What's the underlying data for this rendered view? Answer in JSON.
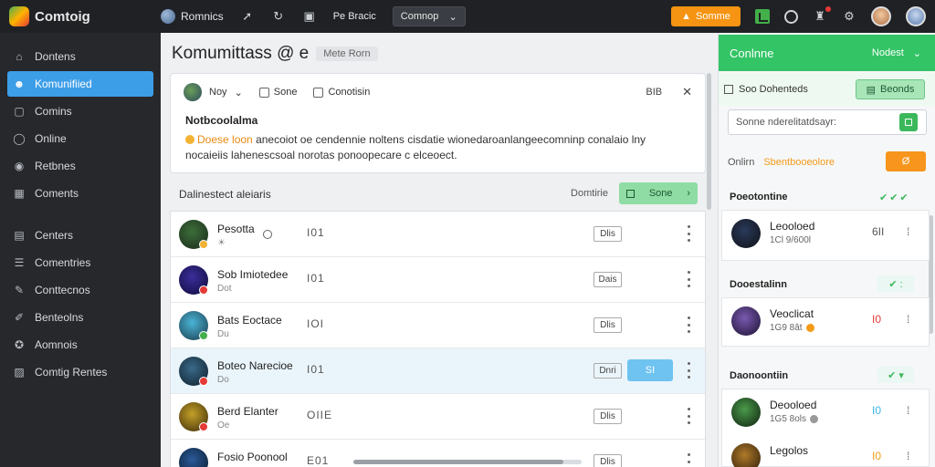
{
  "app": {
    "name": "Comtoig"
  },
  "topbar": {
    "items": [
      "Romnics"
    ],
    "select": "Comnop",
    "select_small": "Pe Bracic",
    "orange_btn": "Somme"
  },
  "sidebar": {
    "group1": [
      {
        "label": "Dontens",
        "icon": "home-icon"
      },
      {
        "label": "Komunifiied",
        "icon": "users-icon",
        "active": true
      },
      {
        "label": "Comins",
        "icon": "square-icon"
      },
      {
        "label": "Online",
        "icon": "chat-icon"
      },
      {
        "label": "Retbnes",
        "icon": "eye-icon"
      },
      {
        "label": "Coments",
        "icon": "building-icon"
      }
    ],
    "group2": [
      {
        "label": "Centers",
        "icon": "grid-icon"
      },
      {
        "label": "Comentries",
        "icon": "list-icon"
      },
      {
        "label": "Conttecnos",
        "icon": "pin-icon"
      },
      {
        "label": "Benteolns",
        "icon": "tag-icon"
      },
      {
        "label": "Aomnois",
        "icon": "game-icon"
      },
      {
        "label": "Comtig Rentes",
        "icon": "chart-icon"
      }
    ]
  },
  "main": {
    "title": "Komumittass @ e",
    "title_chip": "Mete Rorn",
    "composer": {
      "user": "Noy",
      "opt1": "Sone",
      "opt2": "Conotisin",
      "tool1": "BIB",
      "close": "✕",
      "label": "Notbcoolalma",
      "highlight": "Doese loon",
      "line1": "anecoiot oe cendennie noltens cisdatie wionedaroanlangeecomninp conalaio lny",
      "line2_hl": "nocaieiis lahenescsoal",
      "line2": "norotas ponoopecare c elceoect."
    },
    "list": {
      "header": "Dalinestect aleiaris",
      "right_text": "Domtirie",
      "share": "Sone",
      "rows": [
        {
          "name": "Pesotta",
          "sub": "☀",
          "num": "I01",
          "tag": "Dlis",
          "avatar1": "#3d6e3a",
          "avatar2": "#1a2a1a",
          "badge": "#f2b233",
          "ring": true
        },
        {
          "name": "Sob Imiotedee",
          "sub": "Dot",
          "num": "I01",
          "tag": "Dais",
          "avatar1": "#3b2e9a",
          "avatar2": "#0e0b3a",
          "badge": "#e53935"
        },
        {
          "name": "Bats Eoctace",
          "sub": "Du",
          "num": "IOI",
          "tag": "Dlis",
          "avatar1": "#4ab4d6",
          "avatar2": "#1a3a4a",
          "badge": "#43b04a"
        },
        {
          "name": "Boteo Narecioe",
          "sub": "Do",
          "num": "I01",
          "tag": "Dnri",
          "action": "SI",
          "avatar1": "#3a6a8a",
          "avatar2": "#0e1e2a",
          "badge": "#e53935",
          "highlight": true
        },
        {
          "name": "Berd Elanter",
          "sub": "Oe",
          "num": "OIIE",
          "tag": "Dlis",
          "avatar1": "#c4a028",
          "avatar2": "#3a2a0a",
          "badge": "#e53935"
        },
        {
          "name": "Fosio Poonool",
          "sub": "",
          "num": "E01",
          "tag": "Dlis",
          "avatar1": "#2a5a9a",
          "avatar2": "#0a1a2a",
          "badge": "#43b04a"
        }
      ]
    }
  },
  "rpanel": {
    "header": "Conlnne",
    "header_right": "Nodest",
    "sub_label": "Soo Dohenteds",
    "sub_btn": "Beonds",
    "search_value": "Sonne nderelitatdsayr:",
    "online_label": "Onlirn",
    "online_hl": "Sbentbooeolore",
    "online_btn": "Ø",
    "sections": [
      {
        "title": "Poeotontine",
        "icon": "✔✔✔",
        "rows": [
          {
            "name": "Leooloed",
            "meta": "1Cl 9/600l",
            "count": "6II",
            "count_color": "#555",
            "avatar1": "#2a3a5a",
            "avatar2": "#0e1016",
            "dot": ""
          }
        ]
      },
      {
        "title": "Dooestalinn",
        "chip": "✔ :",
        "rows": [
          {
            "name": "Veoclicat",
            "meta": "1G9 8ât",
            "count": "I0",
            "count_color": "#e53935",
            "avatar1": "#7a5ab0",
            "avatar2": "#1a1030",
            "dot": "#f39a18"
          }
        ]
      },
      {
        "title": "Daonoontiin",
        "chip": "✔ ▾",
        "rows": [
          {
            "name": "Deooloed",
            "meta": "1G5 8ols",
            "count": "I0",
            "count_color": "#3db4e8",
            "avatar1": "#4a9a4a",
            "avatar2": "#102010",
            "dot": "#999"
          },
          {
            "name": "Legolos",
            "meta": "",
            "count": "I0",
            "count_color": "#f39a18",
            "avatar1": "#b07a2a",
            "avatar2": "#2a1a08",
            "dot": ""
          }
        ]
      }
    ]
  }
}
